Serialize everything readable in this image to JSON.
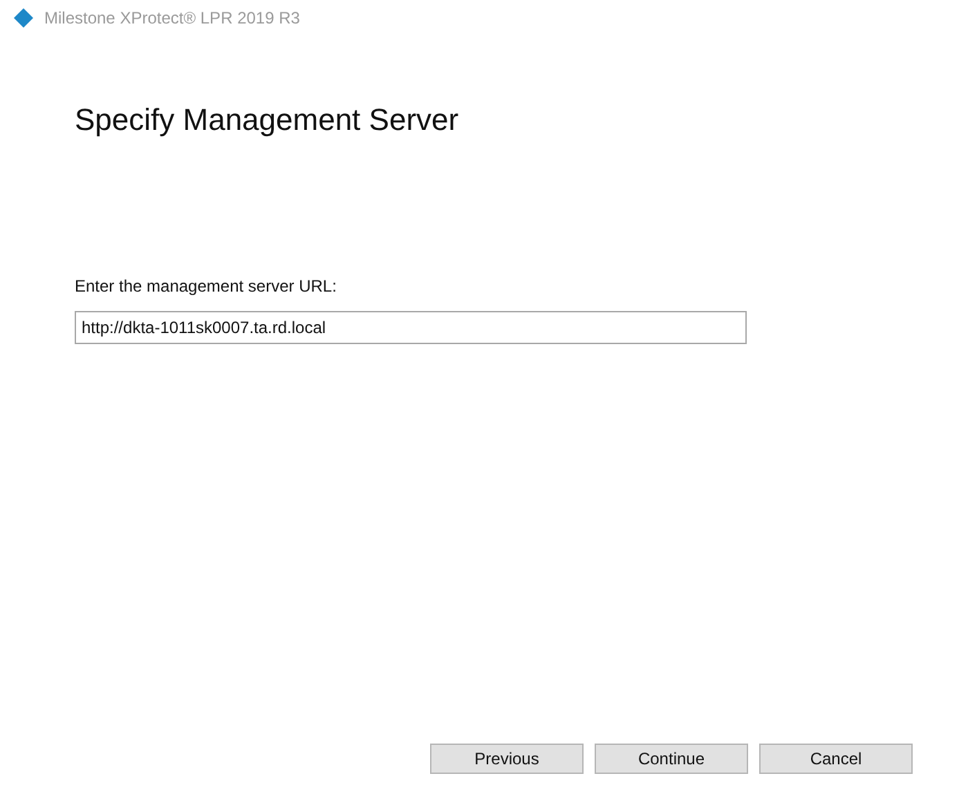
{
  "window": {
    "title": "Milestone XProtect® LPR 2019 R3"
  },
  "heading": "Specify Management Server",
  "url_field": {
    "label": "Enter the management server URL:",
    "value": "http://dkta-1011sk0007.ta.rd.local"
  },
  "buttons": [
    "Previous",
    "Continue",
    "Cancel"
  ]
}
